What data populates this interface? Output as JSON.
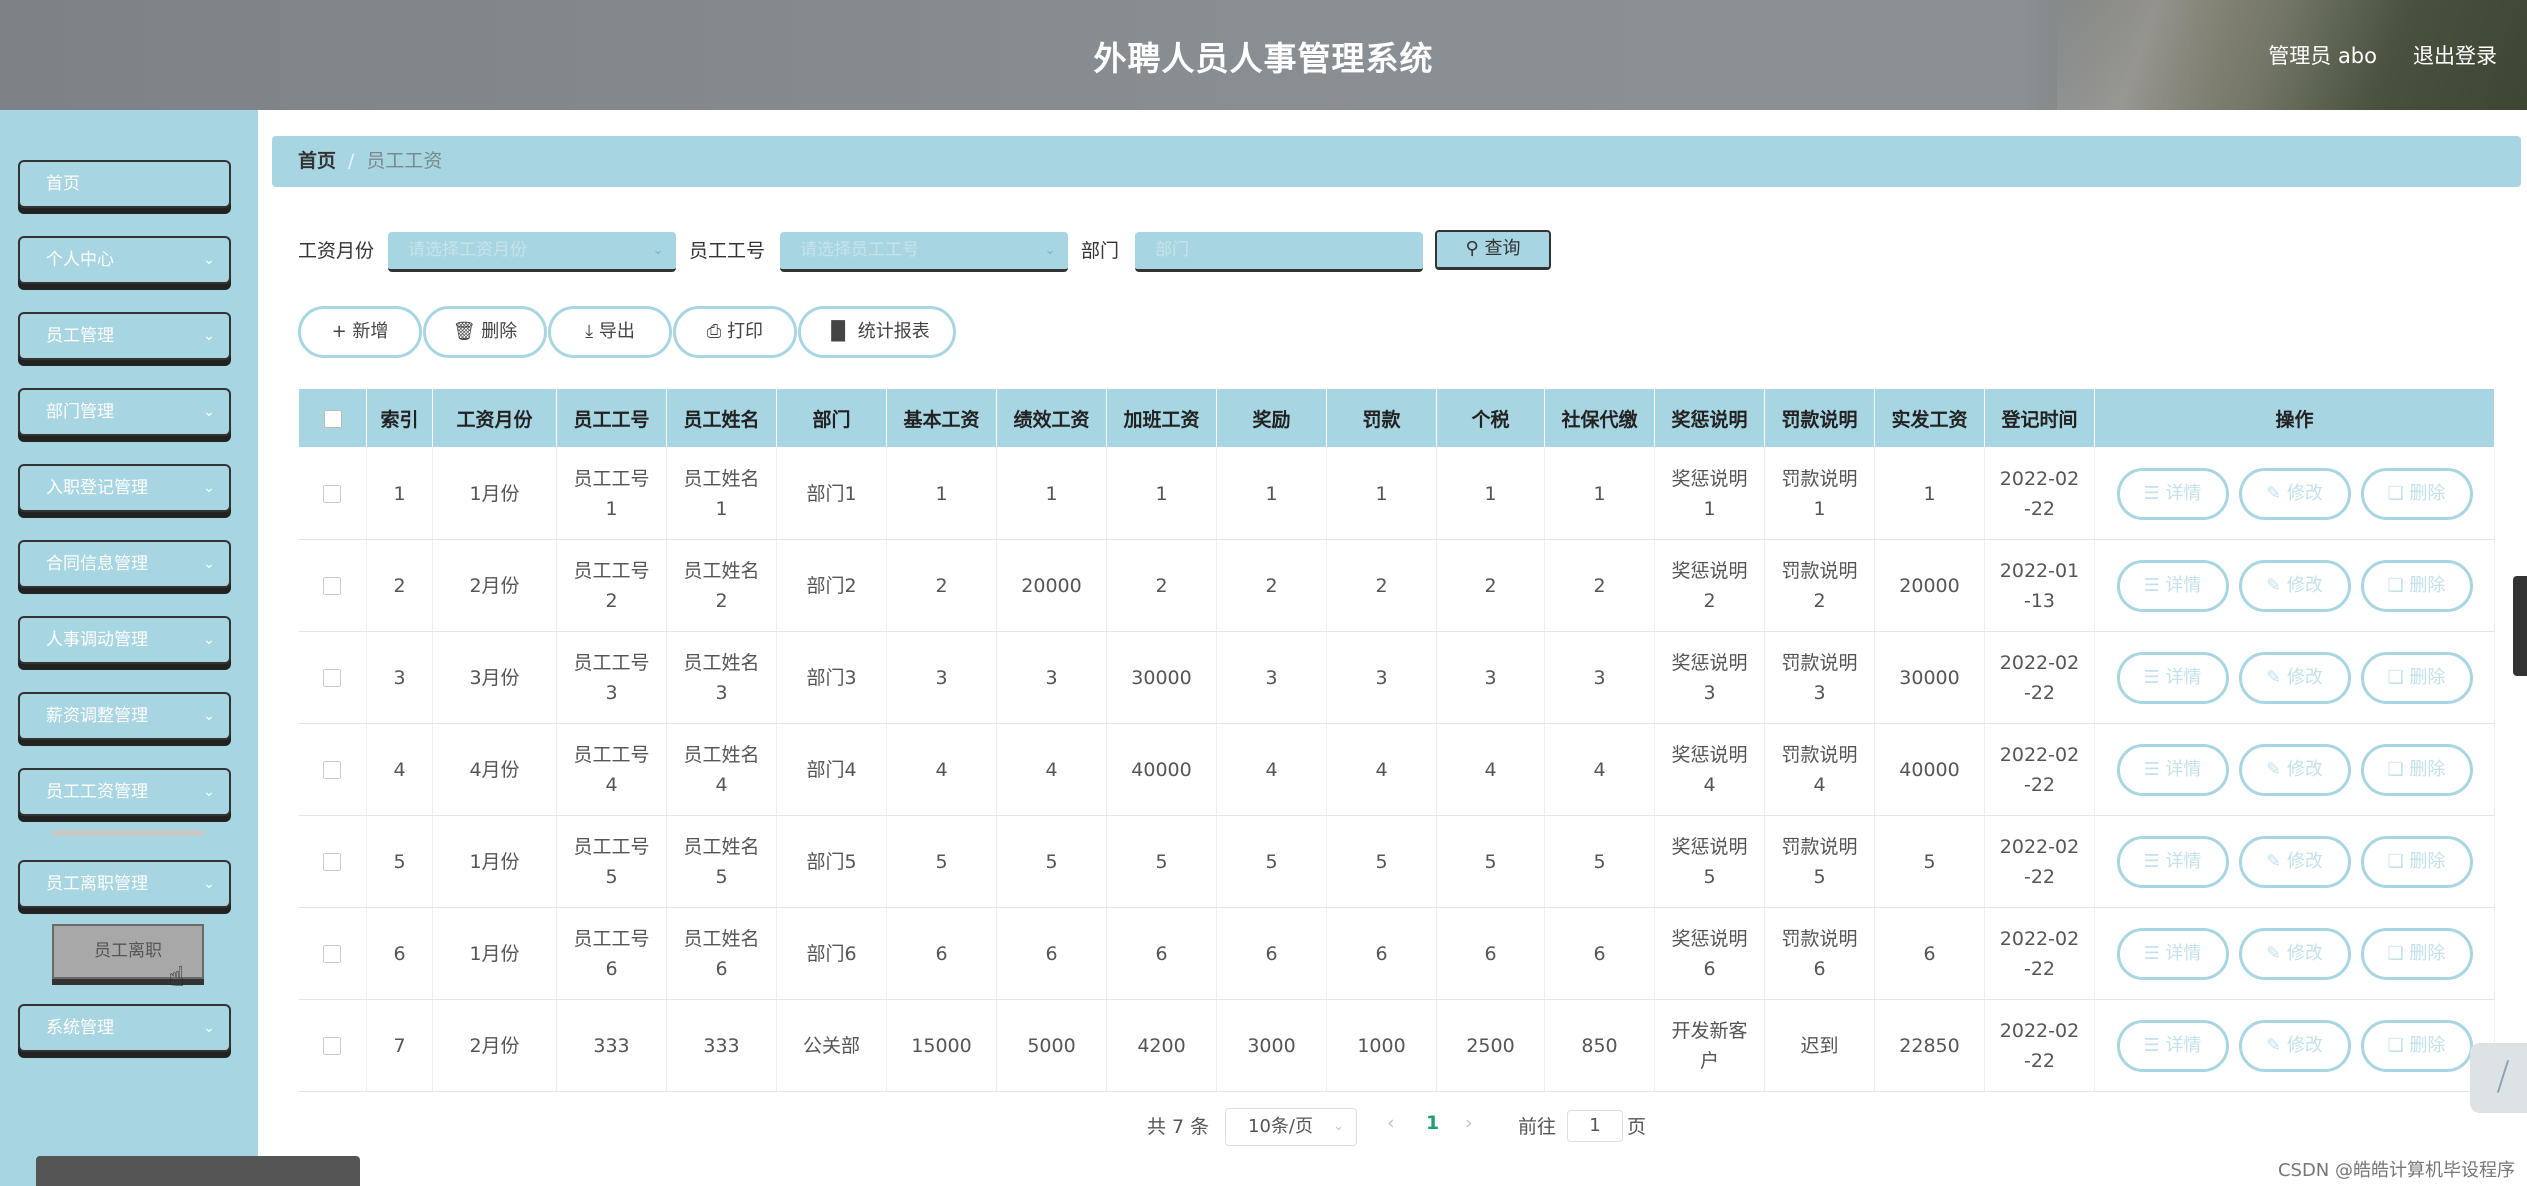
{
  "header": {
    "title": "外聘人员人事管理系统",
    "user": "管理员 abo",
    "logout": "退出登录"
  },
  "sidebar": {
    "items": [
      {
        "label": "首页",
        "has_arrow": false
      },
      {
        "label": "个人中心",
        "has_arrow": true
      },
      {
        "label": "员工管理",
        "has_arrow": true
      },
      {
        "label": "部门管理",
        "has_arrow": true
      },
      {
        "label": "入职登记管理",
        "has_arrow": true
      },
      {
        "label": "合同信息管理",
        "has_arrow": true
      },
      {
        "label": "人事调动管理",
        "has_arrow": true
      },
      {
        "label": "薪资调整管理",
        "has_arrow": true
      },
      {
        "label": "员工工资管理",
        "has_arrow": true
      },
      {
        "label": "员工离职管理",
        "has_arrow": true
      },
      {
        "label": "系统管理",
        "has_arrow": true
      }
    ],
    "submenu_item": "员工离职"
  },
  "breadcrumb": {
    "home": "首页",
    "separator": "/",
    "current": "员工工资"
  },
  "filters": {
    "month_label": "工资月份",
    "month_placeholder": "请选择工资月份",
    "emp_no_label": "员工工号",
    "emp_no_placeholder": "请选择员工工号",
    "dept_label": "部门",
    "dept_placeholder": "部门",
    "query_label": "查询"
  },
  "actions": {
    "add": "新增",
    "delete": "删除",
    "export": "导出",
    "print": "打印",
    "report": "统计报表"
  },
  "table": {
    "headers": [
      "索引",
      "工资月份",
      "员工工号",
      "员工姓名",
      "部门",
      "基本工资",
      "绩效工资",
      "加班工资",
      "奖励",
      "罚款",
      "个税",
      "社保代缴",
      "奖惩说明",
      "罚款说明",
      "实发工资",
      "登记时间",
      "操作"
    ],
    "rows": [
      [
        "1",
        "1月份",
        "员工工号1",
        "员工姓名1",
        "部门1",
        "1",
        "1",
        "1",
        "1",
        "1",
        "1",
        "1",
        "奖惩说明1",
        "罚款说明1",
        "1",
        "2022-02-22"
      ],
      [
        "2",
        "2月份",
        "员工工号2",
        "员工姓名2",
        "部门2",
        "2",
        "20000",
        "2",
        "2",
        "2",
        "2",
        "2",
        "奖惩说明2",
        "罚款说明2",
        "20000",
        "2022-01-13"
      ],
      [
        "3",
        "3月份",
        "员工工号3",
        "员工姓名3",
        "部门3",
        "3",
        "3",
        "30000",
        "3",
        "3",
        "3",
        "3",
        "奖惩说明3",
        "罚款说明3",
        "30000",
        "2022-02-22"
      ],
      [
        "4",
        "4月份",
        "员工工号4",
        "员工姓名4",
        "部门4",
        "4",
        "4",
        "40000",
        "4",
        "4",
        "4",
        "4",
        "奖惩说明4",
        "罚款说明4",
        "40000",
        "2022-02-22"
      ],
      [
        "5",
        "1月份",
        "员工工号5",
        "员工姓名5",
        "部门5",
        "5",
        "5",
        "5",
        "5",
        "5",
        "5",
        "5",
        "奖惩说明5",
        "罚款说明5",
        "5",
        "2022-02-22"
      ],
      [
        "6",
        "1月份",
        "员工工号6",
        "员工姓名6",
        "部门6",
        "6",
        "6",
        "6",
        "6",
        "6",
        "6",
        "6",
        "奖惩说明6",
        "罚款说明6",
        "6",
        "2022-02-22"
      ],
      [
        "7",
        "2月份",
        "333",
        "333",
        "公关部",
        "15000",
        "5000",
        "4200",
        "3000",
        "1000",
        "2500",
        "850",
        "开发新客户",
        "迟到",
        "22850",
        "2022-02-22"
      ]
    ],
    "row_actions": {
      "detail": "详情",
      "edit": "修改",
      "delete": "删除"
    }
  },
  "pagination": {
    "total": "共 7 条",
    "page_size": "10条/页",
    "current_page": "1",
    "goto_label": "前往",
    "goto_value": "1",
    "page_suffix": "页"
  },
  "watermark": "CSDN @皓皓计算机毕设程序",
  "icons": {
    "search": "search-icon",
    "plus": "plus-icon",
    "trash": "trash-icon",
    "download": "download-icon",
    "printer": "printer-icon",
    "bar-chart": "bar-chart-icon",
    "chevron": "chevron-down-icon",
    "doc": "document-icon",
    "pencil": "edit-icon"
  },
  "colors": {
    "accent": "#a8d5e2",
    "header": "#8a8f93",
    "text": "#333333",
    "active_page": "#1fa06f"
  }
}
